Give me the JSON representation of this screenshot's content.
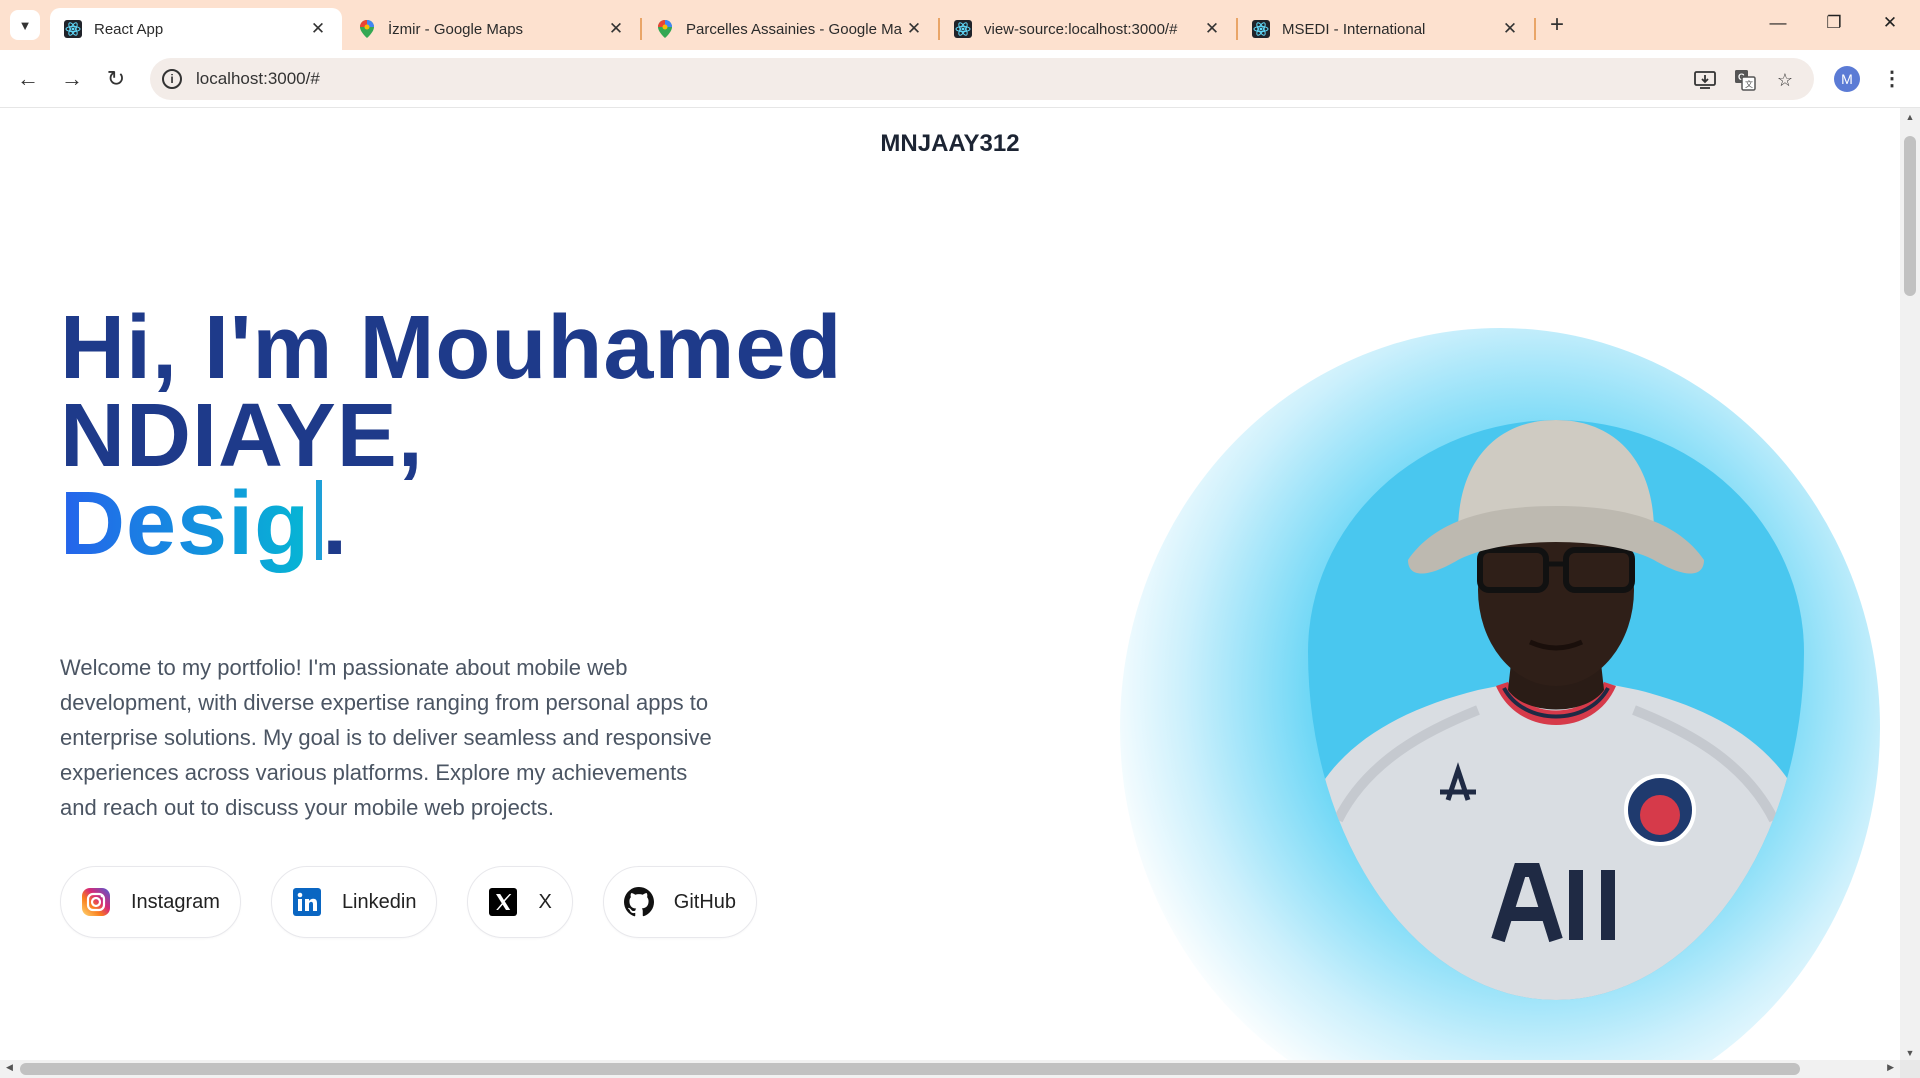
{
  "browser": {
    "tabs": [
      {
        "title": "React App",
        "icon": "react-icon",
        "active": true
      },
      {
        "title": "İzmir - Google Maps",
        "icon": "maps-pin-icon",
        "active": false
      },
      {
        "title": "Parcelles Assainies - Google Ma",
        "icon": "maps-pin-icon",
        "active": false
      },
      {
        "title": "view-source:localhost:3000/#",
        "icon": "react-icon",
        "active": false
      },
      {
        "title": "MSEDI - International",
        "icon": "react-icon",
        "active": false
      }
    ],
    "url": "localhost:3000/#",
    "profile_initial": "M"
  },
  "page": {
    "brand": "MNJAAY312",
    "hero": {
      "line1": "Hi, I'm Mouhamed",
      "line2": "NDIAYE,",
      "typed": "Desig",
      "end": "."
    },
    "intro": "Welcome to my portfolio! I'm passionate about mobile web development, with diverse expertise ranging from personal apps to enterprise solutions. My goal is to deliver seamless and responsive experiences across various platforms. Explore my achievements and reach out to discuss your mobile web projects.",
    "socials": [
      {
        "label": "Instagram",
        "icon": "instagram-icon"
      },
      {
        "label": "Linkedin",
        "icon": "linkedin-icon"
      },
      {
        "label": "X",
        "icon": "x-icon"
      },
      {
        "label": "GitHub",
        "icon": "github-icon"
      }
    ]
  },
  "colors": {
    "tabstrip": "#fde1cf",
    "heading": "#1e3a8a",
    "gradient_start": "#2563eb",
    "gradient_end": "#06b6d4",
    "glow": "#1fc0f0"
  }
}
